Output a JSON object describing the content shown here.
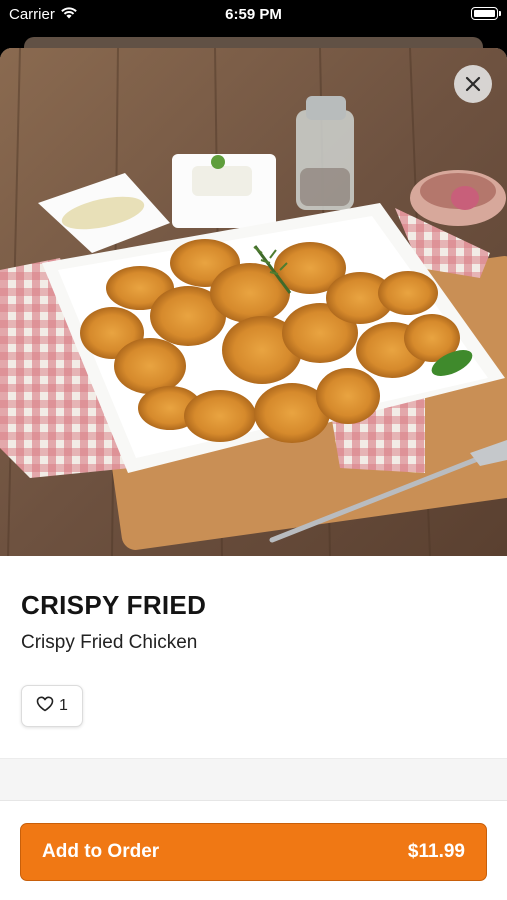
{
  "status_bar": {
    "carrier": "Carrier",
    "time": "6:59 PM"
  },
  "item": {
    "title": "CRISPY FRIED",
    "subtitle": "Crispy Fried Chicken",
    "likes": "1"
  },
  "order": {
    "label": "Add to Order",
    "price": "$11.99"
  },
  "colors": {
    "accent": "#f07814",
    "close_button_bg": "#e6e6e6"
  },
  "icons": {
    "close": "close-icon",
    "heart": "heart-icon",
    "wifi": "wifi-icon",
    "battery": "battery-icon"
  }
}
